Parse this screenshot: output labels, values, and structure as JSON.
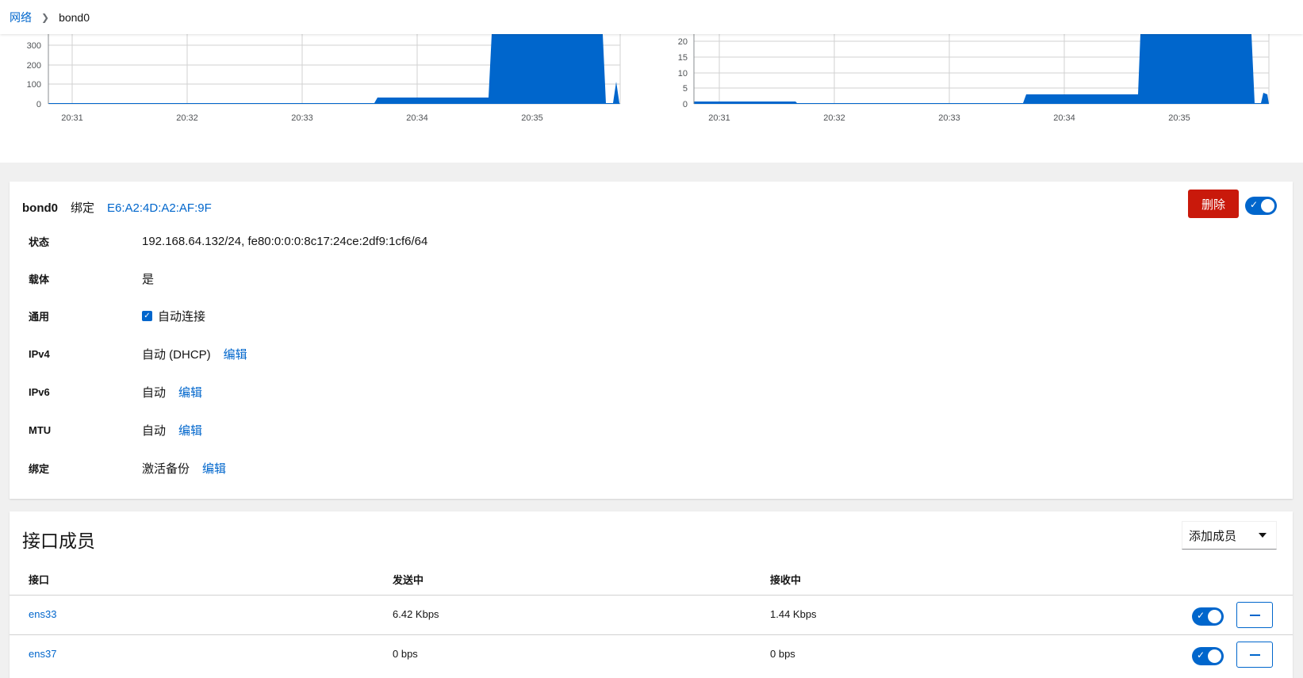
{
  "breadcrumb": {
    "parent": "网络",
    "current": "bond0"
  },
  "charts": [
    {
      "y_ticks": [
        "300",
        "200",
        "100",
        "0"
      ],
      "x_ticks": [
        "20:31",
        "20:32",
        "20:33",
        "20:34",
        "20:35"
      ]
    },
    {
      "y_ticks": [
        "20",
        "15",
        "10",
        "5",
        "0"
      ],
      "x_ticks": [
        "20:31",
        "20:32",
        "20:33",
        "20:34",
        "20:35"
      ]
    }
  ],
  "details": {
    "device": "bond0",
    "kind": "绑定",
    "mac": "E6:A2:4D:A2:AF:9F",
    "delete_label": "删除",
    "rows": [
      {
        "label": "状态",
        "value": "192.168.64.132/24, fe80:0:0:0:8c17:24ce:2df9:1cf6/64"
      },
      {
        "label": "载体",
        "value": "是"
      },
      {
        "label": "通用",
        "value": "自动连接"
      },
      {
        "label": "IPv4",
        "value": "自动 (DHCP)",
        "edit": "编辑"
      },
      {
        "label": "IPv6",
        "value": "自动",
        "edit": "编辑"
      },
      {
        "label": "MTU",
        "value": "自动",
        "edit": "编辑"
      },
      {
        "label": "绑定",
        "value": "激活备份",
        "edit": "编辑"
      }
    ]
  },
  "members": {
    "title": "接口成员",
    "add_label": "添加成员",
    "columns": [
      "接口",
      "发送中",
      "接收中"
    ],
    "rows": [
      {
        "name": "ens33",
        "sending": "6.42 Kbps",
        "receiving": "1.44 Kbps"
      },
      {
        "name": "ens37",
        "sending": "0 bps",
        "receiving": "0 bps"
      }
    ]
  },
  "colors": {
    "accent": "#0066cc",
    "danger": "#c9190b"
  }
}
